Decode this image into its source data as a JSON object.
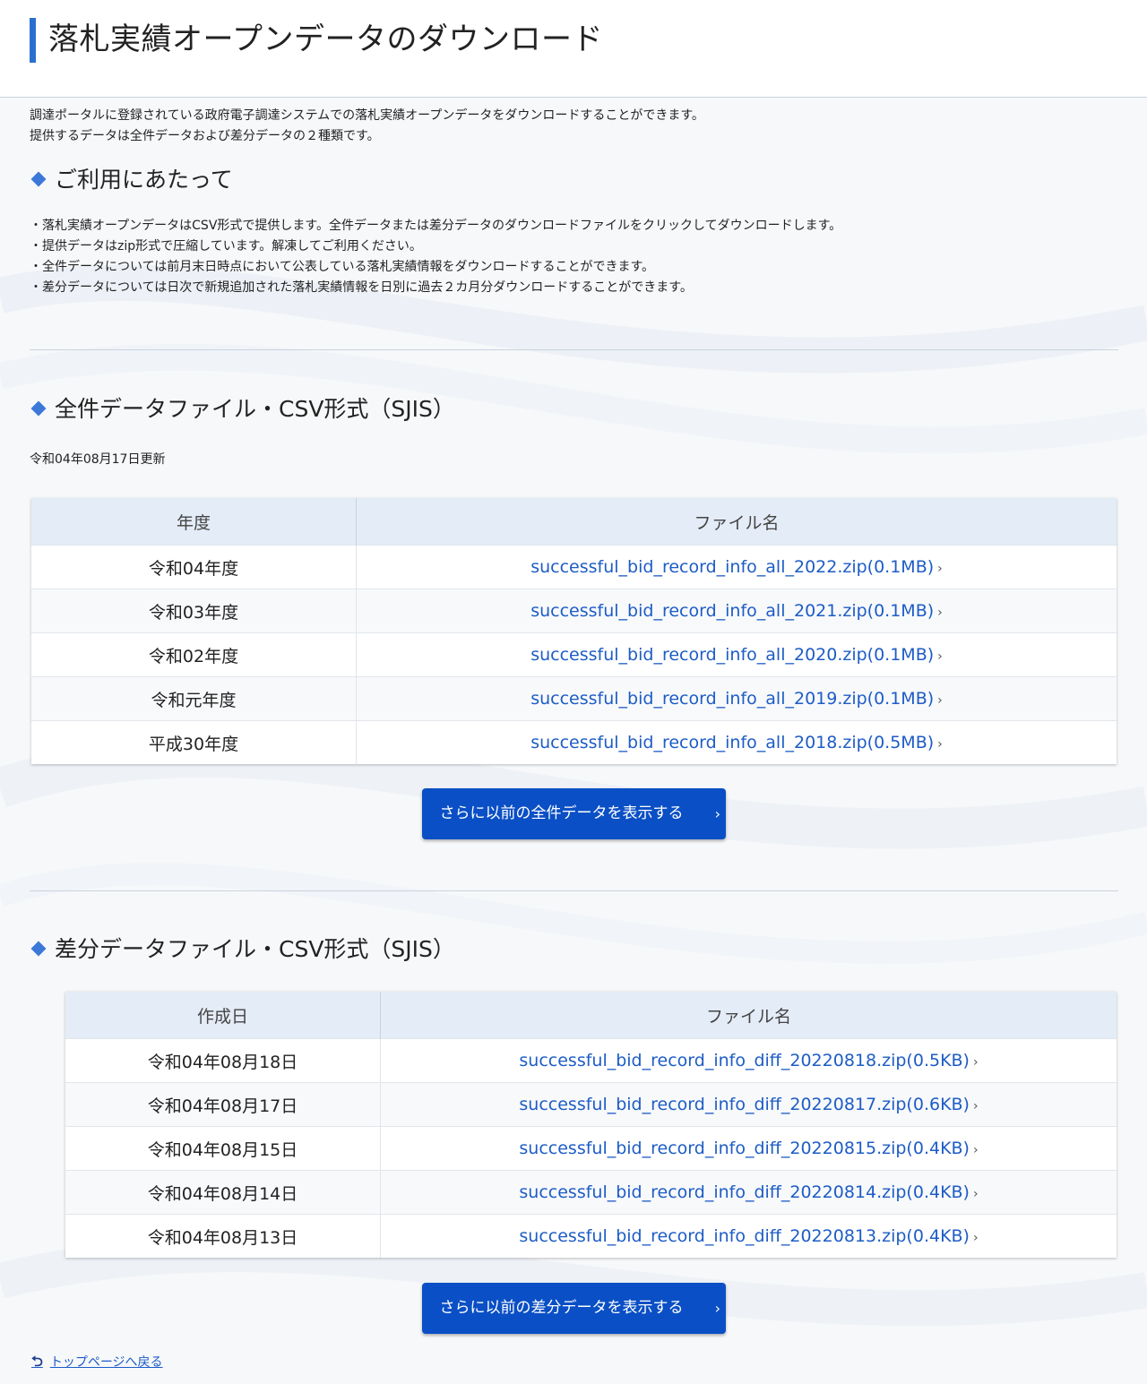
{
  "header": {
    "title": "落札実績オープンデータのダウンロード"
  },
  "intro": [
    "調達ポータルに登録されている政府電子調達システムでの落札実績オープンデータをダウンロードすることができます。",
    "提供するデータは全件データおよび差分データの２種類です。"
  ],
  "usage": {
    "heading": "ご利用にあたって",
    "notes": [
      "・落札実績オープンデータはCSV形式で提供します。全件データまたは差分データのダウンロードファイルをクリックしてダウンロードします。",
      "・提供データはzip形式で圧縮しています。解凍してご利用ください。",
      "・全件データについては前月末日時点において公表している落札実績情報をダウンロードすることができます。",
      "・差分データについては日次で新規追加された落札実績情報を日別に過去２カ月分ダウンロードすることができます。"
    ]
  },
  "full": {
    "heading": "全件データファイル・CSV形式（SJIS）",
    "updated": "令和04年08月17日更新",
    "columns": [
      "年度",
      "ファイル名"
    ],
    "rows": [
      {
        "year": "令和04年度",
        "file": "successful_bid_record_info_all_2022.zip(0.1MB)"
      },
      {
        "year": "令和03年度",
        "file": "successful_bid_record_info_all_2021.zip(0.1MB)"
      },
      {
        "year": "令和02年度",
        "file": "successful_bid_record_info_all_2020.zip(0.1MB)"
      },
      {
        "year": "令和元年度",
        "file": "successful_bid_record_info_all_2019.zip(0.1MB)"
      },
      {
        "year": "平成30年度",
        "file": "successful_bid_record_info_all_2018.zip(0.5MB)"
      }
    ],
    "more_button": "さらに以前の全件データを表示する"
  },
  "diff": {
    "heading": "差分データファイル・CSV形式（SJIS）",
    "columns": [
      "作成日",
      "ファイル名"
    ],
    "rows": [
      {
        "date": "令和04年08月18日",
        "file": "successful_bid_record_info_diff_20220818.zip(0.5KB)"
      },
      {
        "date": "令和04年08月17日",
        "file": "successful_bid_record_info_diff_20220817.zip(0.6KB)"
      },
      {
        "date": "令和04年08月15日",
        "file": "successful_bid_record_info_diff_20220815.zip(0.4KB)"
      },
      {
        "date": "令和04年08月14日",
        "file": "successful_bid_record_info_diff_20220814.zip(0.4KB)"
      },
      {
        "date": "令和04年08月13日",
        "file": "successful_bid_record_info_diff_20220813.zip(0.4KB)"
      }
    ],
    "more_button": "さらに以前の差分データを表示する"
  },
  "footer": {
    "back_link": "トップページへ戻る"
  },
  "icons": {
    "chevron": "chevron-right-icon",
    "back": "return-arrow-icon",
    "bullet": "diamond-icon"
  },
  "colors": {
    "accent": "#2a6fcf",
    "link": "#1d5cc6",
    "button": "#0a4fc5",
    "table_header": "#e4ecf7"
  }
}
